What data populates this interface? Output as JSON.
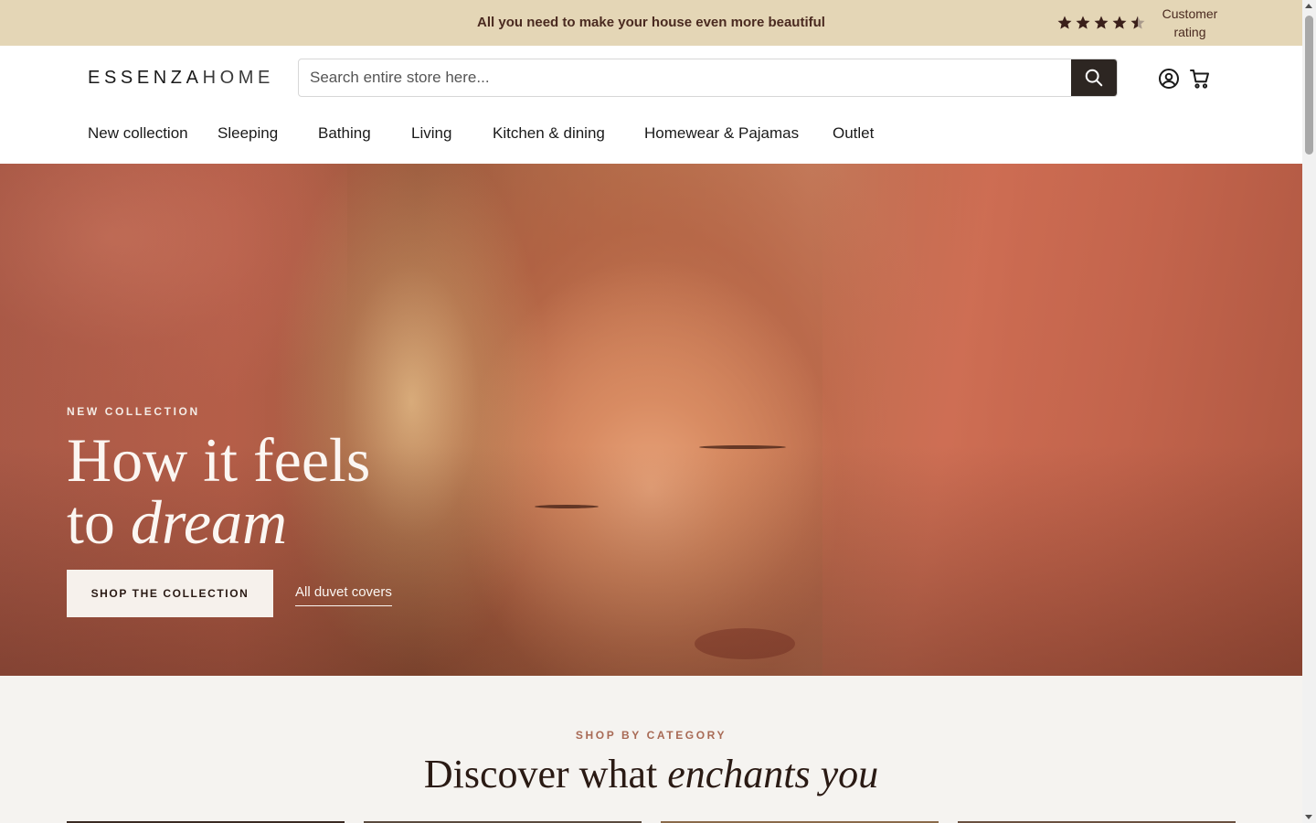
{
  "announcement": {
    "message": "All you need to make your house even more beautiful",
    "rating": {
      "stars": 4.5,
      "max_stars": 5,
      "label": "Customer rating",
      "star_icon": "star-icon",
      "star_color": "#3a1f1a"
    }
  },
  "header": {
    "logo_bold": "ESSENZA",
    "logo_light": "HOME",
    "search": {
      "placeholder": "Search entire store here...",
      "value": "",
      "button_icon": "search-icon"
    },
    "icons": [
      "account-icon",
      "cart-icon"
    ]
  },
  "nav": {
    "items": [
      {
        "label": "New collection"
      },
      {
        "label": "Sleeping"
      },
      {
        "label": "Bathing"
      },
      {
        "label": "Living"
      },
      {
        "label": "Kitchen & dining"
      },
      {
        "label": "Homewear & Pajamas"
      },
      {
        "label": "Outlet"
      }
    ]
  },
  "hero": {
    "eyebrow": "NEW COLLECTION",
    "title_line1": "How it feels",
    "title_line2_plain": "to ",
    "title_line2_italic": "dream",
    "cta_label": "SHOP THE COLLECTION",
    "link_label": "All duvet covers"
  },
  "category": {
    "eyebrow": "SHOP BY CATEGORY",
    "title_plain": "Discover what ",
    "title_italic": "enchants you"
  },
  "colors": {
    "announcement_bg": "#e4d6b6",
    "accent_dark": "#2d2622",
    "eyebrow_accent": "#a86a55",
    "page_bg": "#f5f3f0"
  }
}
